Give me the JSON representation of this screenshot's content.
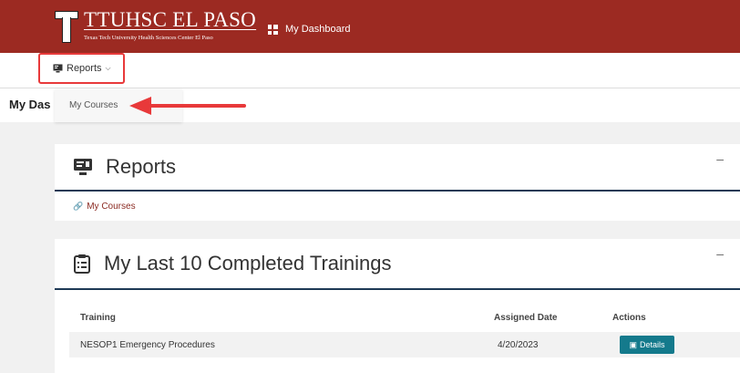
{
  "header": {
    "logo_title": "TTUHSC EL PASO",
    "logo_subtitle": "Texas Tech University Health Sciences Center El Paso",
    "dashboard_label": "My Dashboard"
  },
  "nav": {
    "reports_label": "Reports",
    "dropdown_items": [
      {
        "label": "My Courses"
      }
    ]
  },
  "page": {
    "title_partial": "My Das"
  },
  "reports_card": {
    "title": "Reports",
    "collapse": "–",
    "link_label": "My Courses"
  },
  "trainings_card": {
    "title": "My Last 10 Completed Trainings",
    "collapse": "–",
    "columns": [
      "Training",
      "Assigned Date",
      "Actions"
    ],
    "rows": [
      {
        "training": "NESOP1 Emergency Procedures",
        "assigned_date": "4/20/2023",
        "action_label": "Details"
      }
    ]
  },
  "colors": {
    "brand_red": "#9c2a22",
    "accent_teal": "#147a8c",
    "highlight_red": "#e8393a",
    "divider_navy": "#1e3a56"
  }
}
